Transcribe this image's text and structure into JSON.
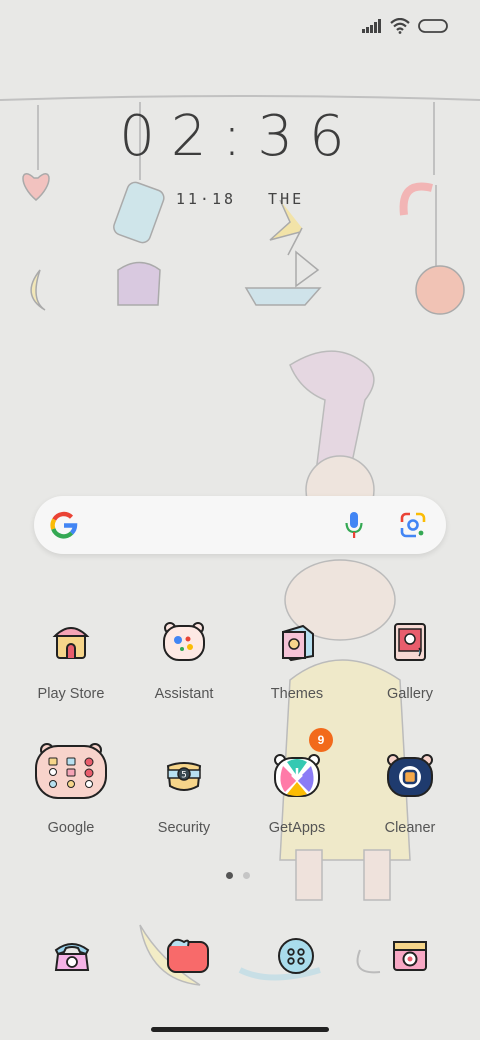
{
  "status_bar": {
    "signal_icon": "signal-icon",
    "wifi_icon": "wifi-icon",
    "battery_icon": "battery-icon"
  },
  "clock": {
    "time": "02:36"
  },
  "date": {
    "day": "11·18",
    "weekday": "THE"
  },
  "search": {
    "logo": "google-g-icon",
    "mic_icon": "microphone-icon",
    "lens_icon": "lens-icon"
  },
  "apps": [
    {
      "label": "Play Store",
      "icon": "play-store-icon"
    },
    {
      "label": "Assistant",
      "icon": "assistant-icon"
    },
    {
      "label": "Themes",
      "icon": "themes-icon"
    },
    {
      "label": "Gallery",
      "icon": "gallery-icon"
    },
    {
      "label": "Google",
      "icon": "google-folder-icon"
    },
    {
      "label": "Security",
      "icon": "security-icon"
    },
    {
      "label": "GetApps",
      "icon": "getapps-icon",
      "badge": "9"
    },
    {
      "label": "Cleaner",
      "icon": "cleaner-icon"
    }
  ],
  "page_indicator": {
    "pages": 2,
    "current": 1
  },
  "dock": [
    {
      "icon": "phone-icon"
    },
    {
      "icon": "messages-icon"
    },
    {
      "icon": "app-drawer-icon"
    },
    {
      "icon": "camera-icon"
    }
  ],
  "colors": {
    "background": "#e8e8e6",
    "badge": "#f26a1b",
    "text": "#555555"
  }
}
